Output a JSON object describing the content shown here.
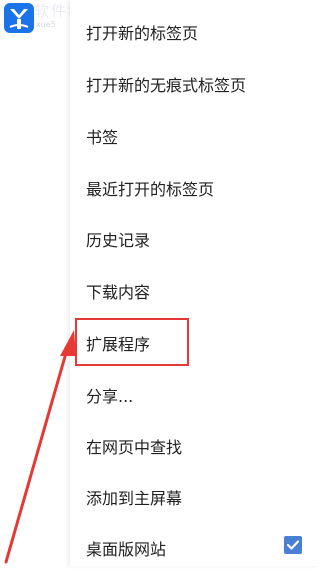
{
  "watermark": {
    "text": "软件学堂",
    "url": "xue5"
  },
  "menu": {
    "items": [
      {
        "label": "打开新的标签页"
      },
      {
        "label": "打开新的无痕式标签页"
      },
      {
        "label": "书签"
      },
      {
        "label": "最近打开的标签页"
      },
      {
        "label": "历史记录"
      },
      {
        "label": "下载内容"
      },
      {
        "label": "扩展程序"
      },
      {
        "label": "分享..."
      },
      {
        "label": "在网页中查找"
      },
      {
        "label": "添加到主屏幕"
      },
      {
        "label": "桌面版网站",
        "checked": true
      }
    ]
  },
  "annotation": {
    "color": "#e53935"
  },
  "colors": {
    "checkbox": "#4a7fd6",
    "text": "#212121"
  }
}
